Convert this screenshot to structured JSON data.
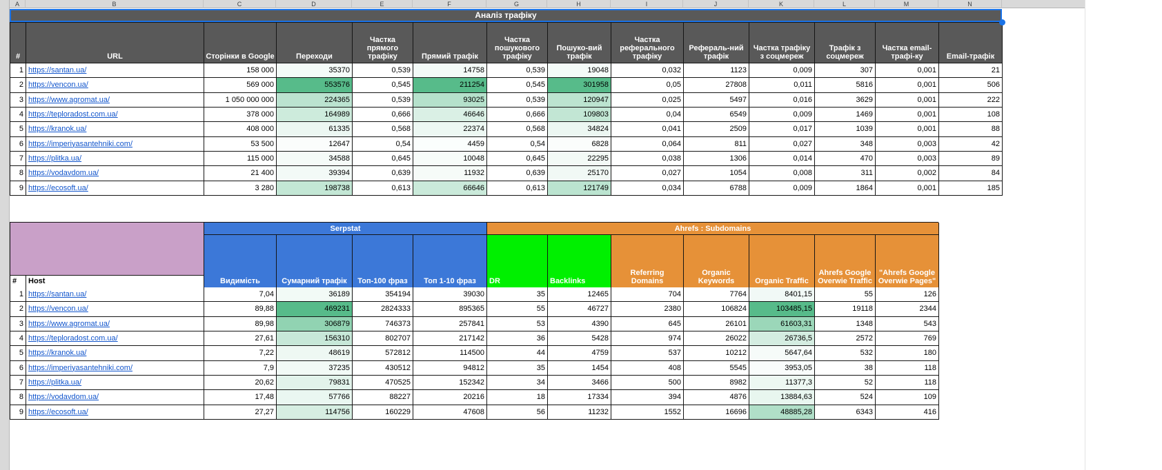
{
  "sheet": {
    "column_letters": [
      "A",
      "B",
      "C",
      "D",
      "E",
      "F",
      "G",
      "H",
      "I",
      "J",
      "K",
      "L",
      "M",
      "N"
    ]
  },
  "colors": {
    "header_gray": "#595959",
    "band_pink": "#C9A0C8",
    "band_blue": "#3C78D8",
    "band_orange": "#E69138",
    "bright_green": "#00F000",
    "link_blue": "#1155CC",
    "heat_green": "#57BB8A",
    "selection_blue": "#1A73E8"
  },
  "table1": {
    "title": "Аналіз трафіку",
    "columns": [
      "#",
      "URL",
      "Сторінки в Google",
      "Переходи",
      "Частка прямого трафіку",
      "Прямий трафік",
      "Частка пошукового трафіку",
      "Пошуко-вий трафік",
      "Частка реферального трафіку",
      "Рефераль-ний трафік",
      "Частка трафіку з соцмереж",
      "Трафік з соцмереж",
      "Частка email-трафі-ку",
      "Email-трафік"
    ],
    "heat_cols": [
      1,
      3,
      5
    ],
    "rows": [
      {
        "num": "1",
        "url": "https://santan.ua/",
        "cells": [
          "158 000",
          "35370",
          "0,539",
          "14758",
          "0,539",
          "19048",
          "0,032",
          "1123",
          "0,009",
          "307",
          "0,001",
          "21"
        ]
      },
      {
        "num": "2",
        "url": "https://vencon.ua/",
        "cells": [
          "569 000",
          "553576",
          "0,545",
          "211254",
          "0,545",
          "301958",
          "0,05",
          "27808",
          "0,011",
          "5816",
          "0,001",
          "506"
        ]
      },
      {
        "num": "3",
        "url": "https://www.agromat.ua/",
        "cells": [
          "1 050 000 000",
          "224365",
          "0,539",
          "93025",
          "0,539",
          "120947",
          "0,025",
          "5497",
          "0,016",
          "3629",
          "0,001",
          "222"
        ]
      },
      {
        "num": "4",
        "url": "https://teploradost.com.ua/",
        "cells": [
          "378 000",
          "164989",
          "0,666",
          "46646",
          "0,666",
          "109803",
          "0,04",
          "6549",
          "0,009",
          "1469",
          "0,001",
          "108"
        ]
      },
      {
        "num": "5",
        "url": "https://kranok.ua/",
        "cells": [
          "408 000",
          "61335",
          "0,568",
          "22374",
          "0,568",
          "34824",
          "0,041",
          "2509",
          "0,017",
          "1039",
          "0,001",
          "88"
        ]
      },
      {
        "num": "6",
        "url": "https://imperiyasantehniki.com/",
        "cells": [
          "53 500",
          "12647",
          "0,54",
          "4459",
          "0,54",
          "6828",
          "0,064",
          "811",
          "0,027",
          "348",
          "0,003",
          "42"
        ]
      },
      {
        "num": "7",
        "url": "https://plitka.ua/",
        "cells": [
          "115 000",
          "34588",
          "0,645",
          "10048",
          "0,645",
          "22295",
          "0,038",
          "1306",
          "0,014",
          "470",
          "0,003",
          "89"
        ]
      },
      {
        "num": "8",
        "url": "https://vodavdom.ua/",
        "cells": [
          "21 400",
          "39394",
          "0,639",
          "11932",
          "0,639",
          "25170",
          "0,027",
          "1054",
          "0,008",
          "311",
          "0,002",
          "84"
        ]
      },
      {
        "num": "9",
        "url": "https://ecosoft.ua/",
        "cells": [
          "3 280",
          "198738",
          "0,613",
          "66646",
          "0,613",
          "121749",
          "0,034",
          "6788",
          "0,009",
          "1864",
          "0,001",
          "185"
        ]
      }
    ]
  },
  "table2": {
    "hash_label": "#",
    "host_label": "Host",
    "band_serpstat": "Serpstat",
    "band_ahrefs": "Ahrefs : Subdomains",
    "columns": [
      "Видимість",
      "Сумарний трафік",
      "Топ-100 фраз",
      "Топ 1-10 фраз",
      "DR",
      "Backlinks",
      "Referring Domains",
      "Organic Keywords",
      "Organic Traffic",
      "Ahrefs Google Overwie Traffic",
      "\"Ahrefs Google Overwie Pages\""
    ],
    "heat_cols": [
      1,
      8
    ],
    "rows": [
      {
        "num": "1",
        "url": "https://santan.ua/",
        "cells": [
          "7,04",
          "36189",
          "354194",
          "39030",
          "35",
          "12465",
          "704",
          "7764",
          "8401,15",
          "55",
          "126"
        ]
      },
      {
        "num": "2",
        "url": "https://vencon.ua/",
        "cells": [
          "89,88",
          "469231",
          "2824333",
          "895365",
          "55",
          "46727",
          "2380",
          "106824",
          "103485,15",
          "19118",
          "2344"
        ]
      },
      {
        "num": "3",
        "url": "https://www.agromat.ua/",
        "cells": [
          "89,98",
          "306879",
          "746373",
          "257841",
          "53",
          "4390",
          "645",
          "26101",
          "61603,31",
          "1348",
          "543"
        ]
      },
      {
        "num": "4",
        "url": "https://teploradost.com.ua/",
        "cells": [
          "27,61",
          "156310",
          "802707",
          "217142",
          "36",
          "5428",
          "974",
          "26022",
          "26736,5",
          "2572",
          "769"
        ]
      },
      {
        "num": "5",
        "url": "https://kranok.ua/",
        "cells": [
          "7,22",
          "48619",
          "572812",
          "114500",
          "44",
          "4759",
          "537",
          "10212",
          "5647,64",
          "532",
          "180"
        ]
      },
      {
        "num": "6",
        "url": "https://imperiyasantehniki.com/",
        "cells": [
          "7,9",
          "37235",
          "430512",
          "94812",
          "35",
          "1454",
          "408",
          "5545",
          "3953,05",
          "38",
          "118"
        ]
      },
      {
        "num": "7",
        "url": "https://plitka.ua/",
        "cells": [
          "20,62",
          "79831",
          "470525",
          "152342",
          "34",
          "3466",
          "500",
          "8982",
          "11377,3",
          "52",
          "118"
        ]
      },
      {
        "num": "8",
        "url": "https://vodavdom.ua/",
        "cells": [
          "17,48",
          "57766",
          "88227",
          "20216",
          "18",
          "17334",
          "394",
          "4876",
          "13884,63",
          "524",
          "109"
        ]
      },
      {
        "num": "9",
        "url": "https://ecosoft.ua/",
        "cells": [
          "27,27",
          "114756",
          "160229",
          "47608",
          "56",
          "11232",
          "1552",
          "16696",
          "48885,28",
          "6343",
          "416"
        ]
      }
    ]
  }
}
